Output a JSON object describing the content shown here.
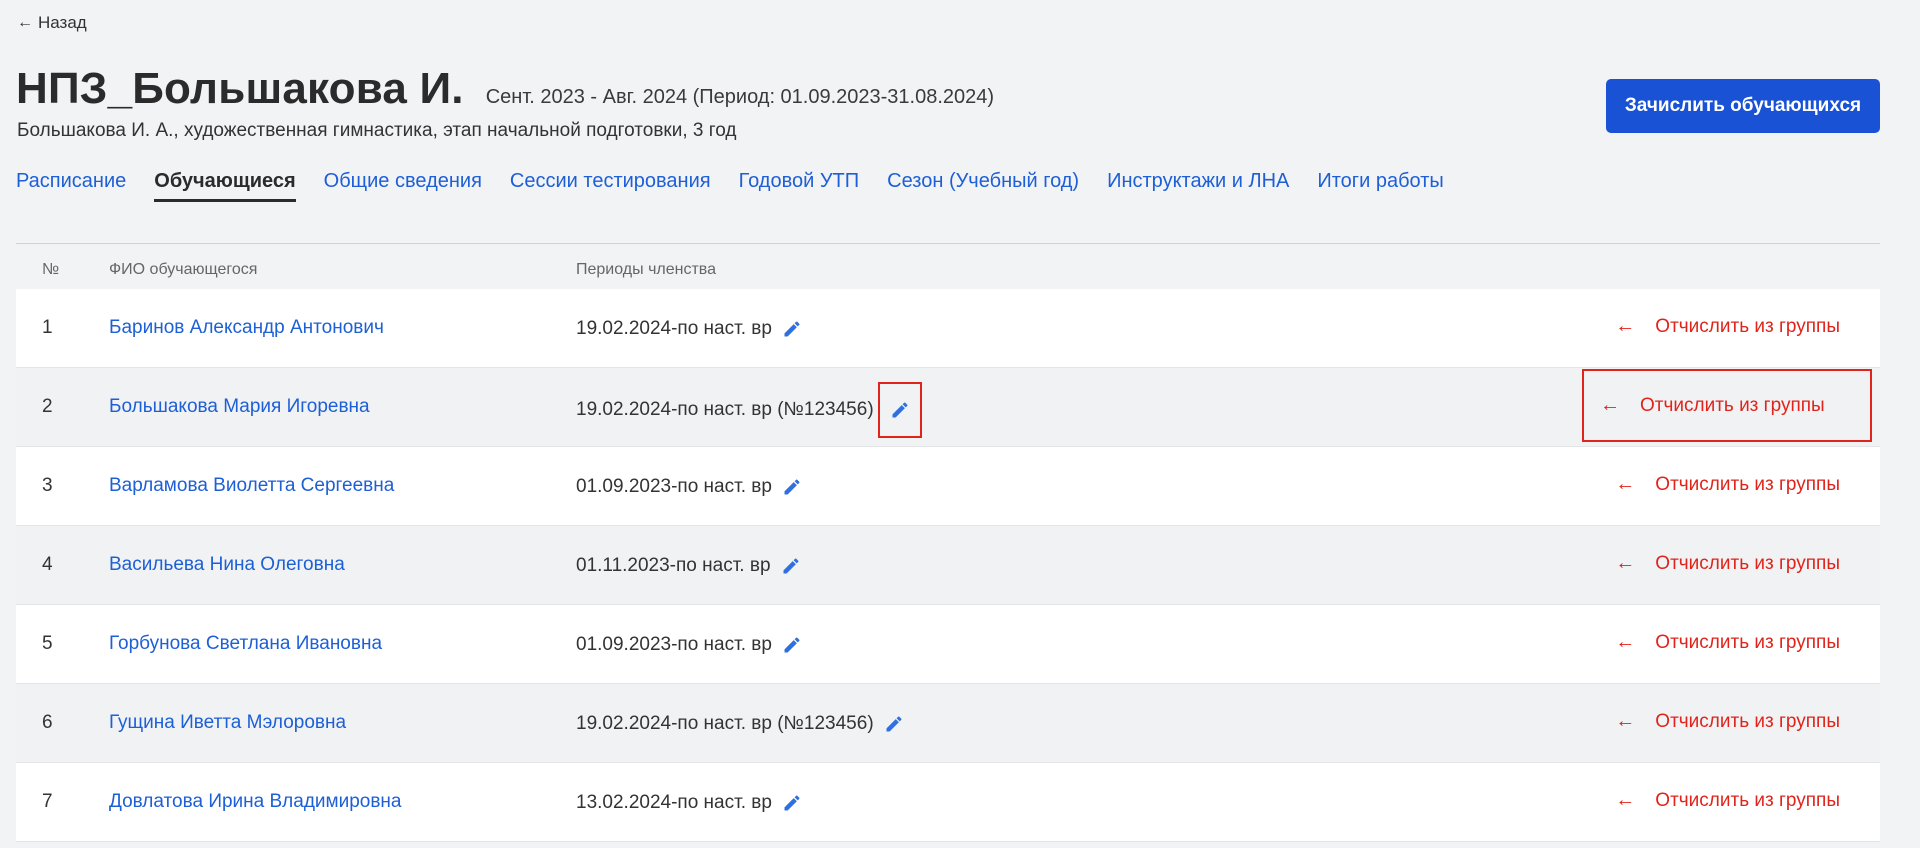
{
  "nav": {
    "back_label": "Назад"
  },
  "header": {
    "title": "НПЗ_Большакова И.",
    "period": "Сент. 2023 - Авг. 2024 (Период: 01.09.2023-31.08.2024)",
    "subtitle": "Большакова И. А., художественная гимнастика, этап начальной подготовки, 3 год",
    "enroll_button": "Зачислить обучающихся"
  },
  "tabs": [
    {
      "label": "Расписание"
    },
    {
      "label": "Обучающиеся",
      "active": true
    },
    {
      "label": "Общие сведения"
    },
    {
      "label": "Сессии тестирования"
    },
    {
      "label": "Годовой УТП"
    },
    {
      "label": "Сезон (Учебный год)"
    },
    {
      "label": "Инструктажи и ЛНА"
    },
    {
      "label": "Итоги работы"
    }
  ],
  "table": {
    "headers": {
      "num": "№",
      "name": "ФИО обучающегося",
      "periods": "Периоды членства"
    },
    "expel_label": "Отчислить из группы",
    "rows": [
      {
        "num": "1",
        "name": "Баринов Александр Антонович",
        "period": "19.02.2024-по наст. вр"
      },
      {
        "num": "2",
        "name": "Большакова Мария Игоревна",
        "period": "19.02.2024-по наст. вр (№123456)"
      },
      {
        "num": "3",
        "name": "Варламова Виолетта Сергеевна",
        "period": "01.09.2023-по наст. вр"
      },
      {
        "num": "4",
        "name": "Васильева Нина Олеговна",
        "period": "01.11.2023-по наст. вр"
      },
      {
        "num": "5",
        "name": "Горбунова Светлана Ивановна",
        "period": "01.09.2023-по наст. вр"
      },
      {
        "num": "6",
        "name": "Гущина Иветта Мэлоровна",
        "period": "19.02.2024-по наст. вр (№123456)"
      },
      {
        "num": "7",
        "name": "Довлатова Ирина Владимировна",
        "period": "13.02.2024-по наст. вр"
      }
    ]
  },
  "colors": {
    "accent": "#1a52d6",
    "link": "#1d5fd6",
    "danger": "#e0241b"
  },
  "icons": {
    "edit": "pencil-icon",
    "back": "arrow-left-icon",
    "expel": "arrow-left-icon"
  }
}
